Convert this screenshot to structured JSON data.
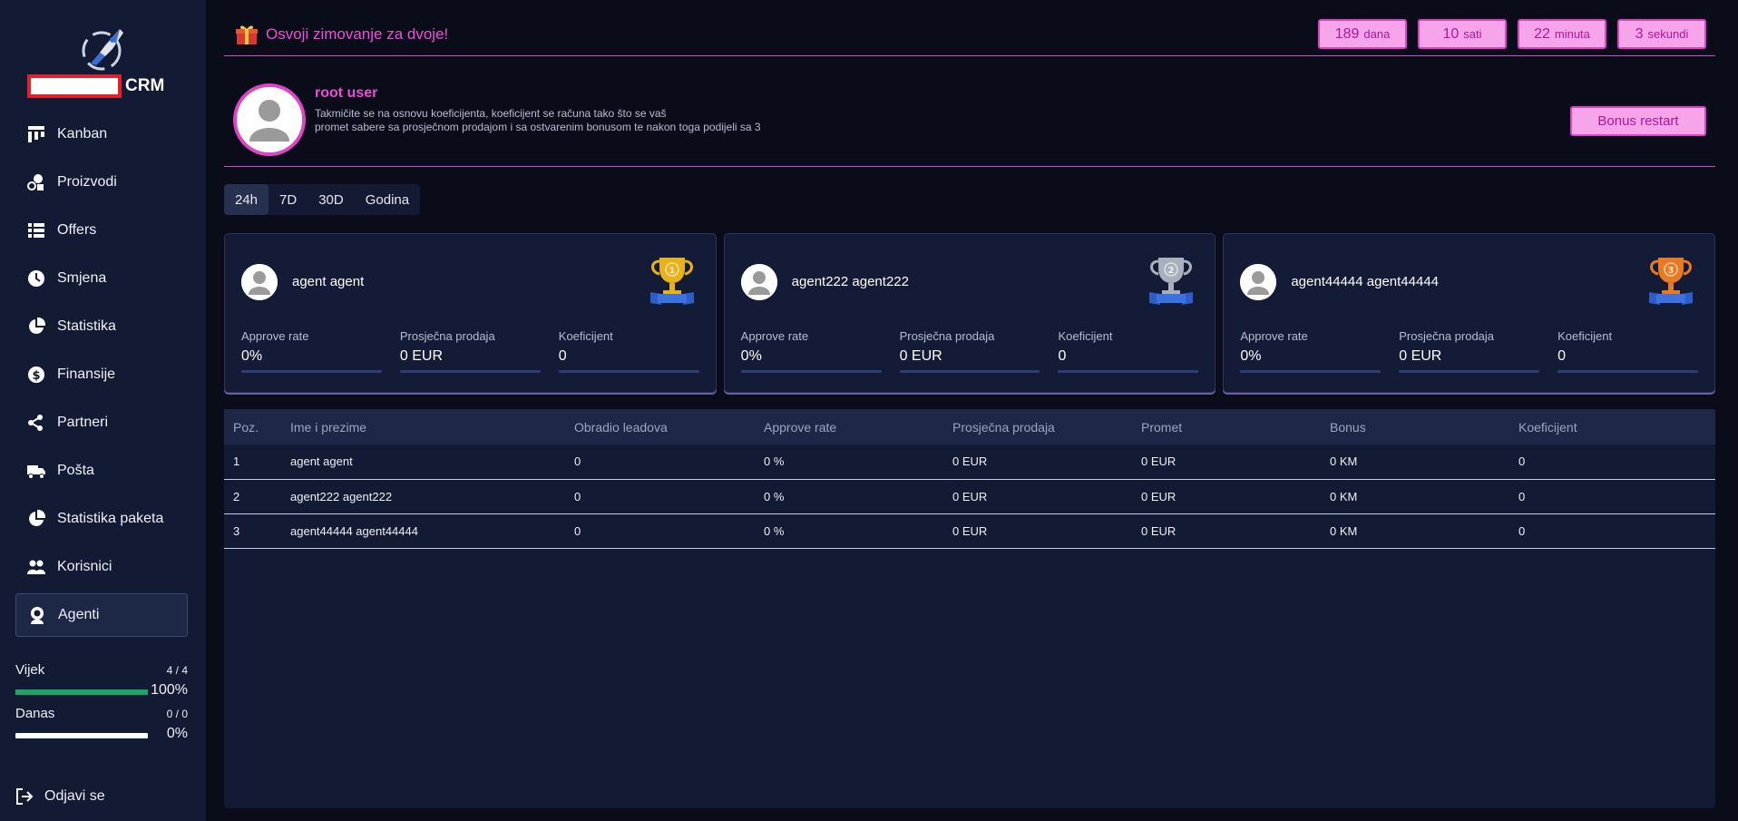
{
  "sidebar": {
    "brand": "CRM",
    "items": [
      {
        "label": "Kanban",
        "icon": "kanban-icon"
      },
      {
        "label": "Proizvodi",
        "icon": "products-icon"
      },
      {
        "label": "Offers",
        "icon": "list-icon"
      },
      {
        "label": "Smjena",
        "icon": "clock-icon"
      },
      {
        "label": "Statistika",
        "icon": "pie-chart-icon"
      },
      {
        "label": "Finansije",
        "icon": "dollar-icon"
      },
      {
        "label": "Partneri",
        "icon": "partners-icon"
      },
      {
        "label": "Pošta",
        "icon": "truck-icon"
      },
      {
        "label": "Statistika paketa",
        "icon": "pie-chart-icon"
      },
      {
        "label": "Korisnici",
        "icon": "users-icon"
      },
      {
        "label": "Agenti",
        "icon": "agent-icon"
      }
    ],
    "active_item": "Agenti",
    "progress": [
      {
        "title": "Vijek",
        "count": "4 / 4",
        "percent_label": "100%",
        "fraction": 1.0
      },
      {
        "title": "Danas",
        "count": "0 / 0",
        "percent_label": "0%",
        "fraction": 0.0
      }
    ],
    "logout": "Odjavi se"
  },
  "topbar": {
    "promo": "Osvoji zimovanje za dvoje!",
    "countdown": [
      {
        "value": "189",
        "unit": "dana"
      },
      {
        "value": "10",
        "unit": "sati"
      },
      {
        "value": "22",
        "unit": "minuta"
      },
      {
        "value": "3",
        "unit": "sekundi"
      }
    ]
  },
  "user": {
    "name": "root user",
    "description_line1": "Takmičite se na osnovu koeficijenta, koeficijent se računa tako što se vaš",
    "description_line2": "promet sabere sa prosječnom prodajom i sa ostvarenim bonusom te nakon toga podijeli sa 3",
    "bonus_button": "Bonus restart"
  },
  "tabs": [
    "24h",
    "7D",
    "30D",
    "Godina"
  ],
  "active_tab": "24h",
  "podium": [
    {
      "rank": "1",
      "name": "agent agent",
      "trophy_color": "#e8b21a",
      "stats": [
        {
          "label": "Approve rate",
          "value": "0%"
        },
        {
          "label": "Prosječna prodaja",
          "value": "0 EUR"
        },
        {
          "label": "Koeficijent",
          "value": "0"
        }
      ]
    },
    {
      "rank": "2",
      "name": "agent222 agent222",
      "trophy_color": "#a9b0bd",
      "stats": [
        {
          "label": "Approve rate",
          "value": "0%"
        },
        {
          "label": "Prosječna prodaja",
          "value": "0 EUR"
        },
        {
          "label": "Koeficijent",
          "value": "0"
        }
      ]
    },
    {
      "rank": "3",
      "name": "agent44444 agent44444",
      "trophy_color": "#e87a23",
      "stats": [
        {
          "label": "Approve rate",
          "value": "0%"
        },
        {
          "label": "Prosječna prodaja",
          "value": "0 EUR"
        },
        {
          "label": "Koeficijent",
          "value": "0"
        }
      ]
    }
  ],
  "table": {
    "headers": [
      "Poz.",
      "Ime i prezime",
      "Obradio leadova",
      "Approve rate",
      "Prosječna prodaja",
      "Promet",
      "Bonus",
      "Koeficijent"
    ],
    "rows": [
      [
        "1",
        "agent agent",
        "0",
        "0 %",
        "0 EUR",
        "0 EUR",
        "0 KM",
        "0"
      ],
      [
        "2",
        "agent222 agent222",
        "0",
        "0 %",
        "0 EUR",
        "0 EUR",
        "0 KM",
        "0"
      ],
      [
        "3",
        "agent44444 agent44444",
        "0",
        "0 %",
        "0 EUR",
        "0 EUR",
        "0 KM",
        "0"
      ]
    ]
  },
  "colors": {
    "accent_pink": "#ec4fd6",
    "button_fill": "#f6a5ea",
    "progress_green": "#1aa36a",
    "sidebar_bg": "#131a33",
    "page_bg": "#0b0c1a"
  }
}
